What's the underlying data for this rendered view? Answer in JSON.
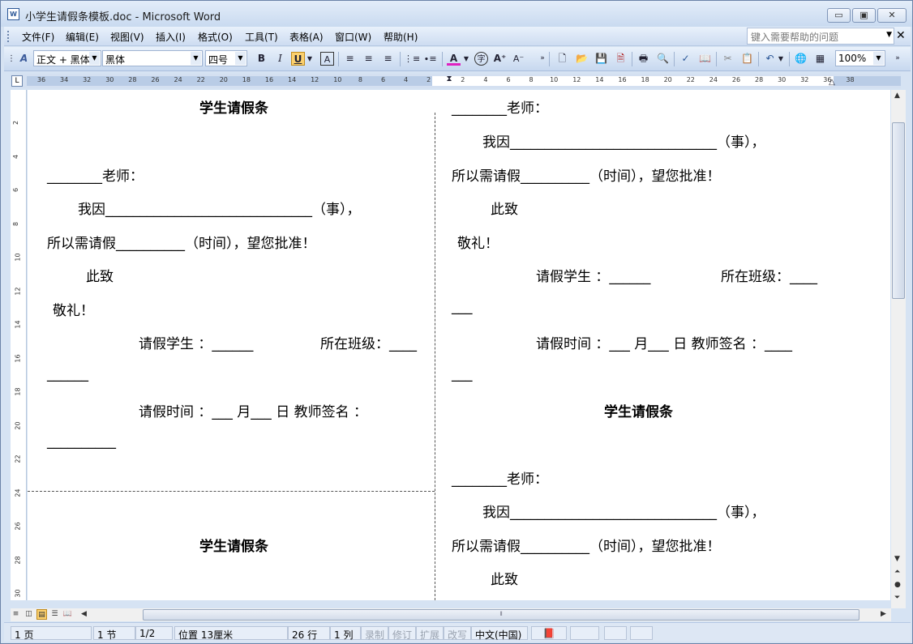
{
  "window": {
    "title": "小学生请假条模板.doc - Microsoft Word"
  },
  "menu": {
    "items": [
      "文件(F)",
      "编辑(E)",
      "视图(V)",
      "插入(I)",
      "格式(O)",
      "工具(T)",
      "表格(A)",
      "窗口(W)",
      "帮助(H)"
    ],
    "help_placeholder": "键入需要帮助的问题"
  },
  "toolbar": {
    "style": "正文 + 黑体",
    "font": "黑体",
    "size": "四号",
    "zoom": "100%"
  },
  "ruler": {
    "labels": [
      "36",
      "34",
      "32",
      "30",
      "28",
      "26",
      "24",
      "22",
      "20",
      "18",
      "16",
      "14",
      "12",
      "10",
      "8",
      "6",
      "4",
      "2",
      "2",
      "4",
      "6",
      "8",
      "10",
      "12",
      "14",
      "16",
      "18",
      "20",
      "22",
      "24",
      "26",
      "28",
      "30",
      "32",
      "36",
      "38"
    ],
    "vlabels": [
      "2",
      "4",
      "6",
      "8",
      "10",
      "12",
      "14",
      "16",
      "18",
      "20",
      "22",
      "24",
      "26",
      "28",
      "30"
    ]
  },
  "document": {
    "left": {
      "title1": "学生请假条",
      "teacher": "________老师：",
      "reason": "我因______________________________（事），",
      "need": "所以需请假__________（时间），望您批准！",
      "cizhi": "此致",
      "jingli": "敬礼！",
      "student": "请假学生 ：______",
      "class": "所在班级：____",
      "class_cont": "______",
      "time": "请假时间 ：___ 月___ 日  教师签名 ：",
      "sign_cont": "__________",
      "title2": "学生请假条"
    },
    "right": {
      "teacher": "________老师：",
      "reason": "我因______________________________（事），",
      "need": "所以需请假__________（时间），望您批准！",
      "cizhi": "此致",
      "jingli": "敬礼！",
      "student": "请假学生 ：______",
      "class": "所在班级：____",
      "class_cont": "___",
      "time": "请假时间 ：___ 月___ 日  教师签名 ：____",
      "time_cont": "___",
      "title": "学生请假条",
      "teacher2": "________老师：",
      "reason2": "我因______________________________（事），",
      "need2": "所以需请假__________（时间），望您批准！",
      "cizhi2": "此致"
    }
  },
  "status": {
    "page": "1 页",
    "section": "1 节",
    "pages": "1/2",
    "position": "位置 13厘米",
    "row": "26 行",
    "col": "1 列",
    "rec": "录制",
    "trk": "修订",
    "ext": "扩展",
    "ovr": "改写",
    "lang": "中文(中国)"
  }
}
